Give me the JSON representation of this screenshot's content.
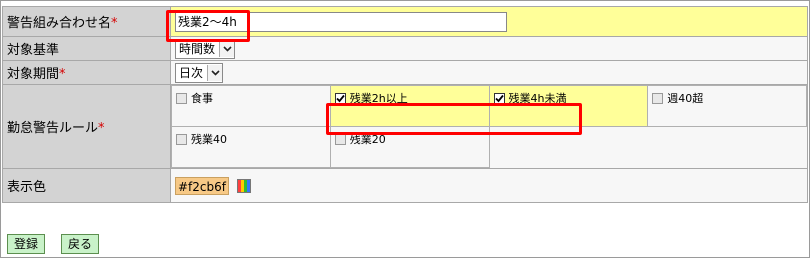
{
  "form": {
    "name_label": "警告組み合わせ名",
    "name_required_mark": "*",
    "name_value": "残業2～4h",
    "basis_label": "対象基準",
    "basis_selected": "時間数",
    "period_label": "対象期間",
    "period_required_mark": "*",
    "period_selected": "日次",
    "rules_label": "勤怠警告ルール",
    "rules_required_mark": "*",
    "rules": [
      {
        "label": "食事",
        "checked": false
      },
      {
        "label": "残業2h以上",
        "checked": true
      },
      {
        "label": "残業4h未満",
        "checked": true
      },
      {
        "label": "週40超",
        "checked": false
      },
      {
        "label": "残業40",
        "checked": false
      },
      {
        "label": "残業20",
        "checked": false
      }
    ],
    "color_label": "表示色",
    "color_value": "#f2cb6f",
    "color_chip_bg": "#f7c986"
  },
  "buttons": {
    "register": "登録",
    "back": "戻る"
  },
  "colors": {
    "label_bg": "#d3d3d3",
    "highlight_yellow": "#ffff99",
    "annotation_red": "#ff0000",
    "button_green": "#c9f2c9"
  }
}
